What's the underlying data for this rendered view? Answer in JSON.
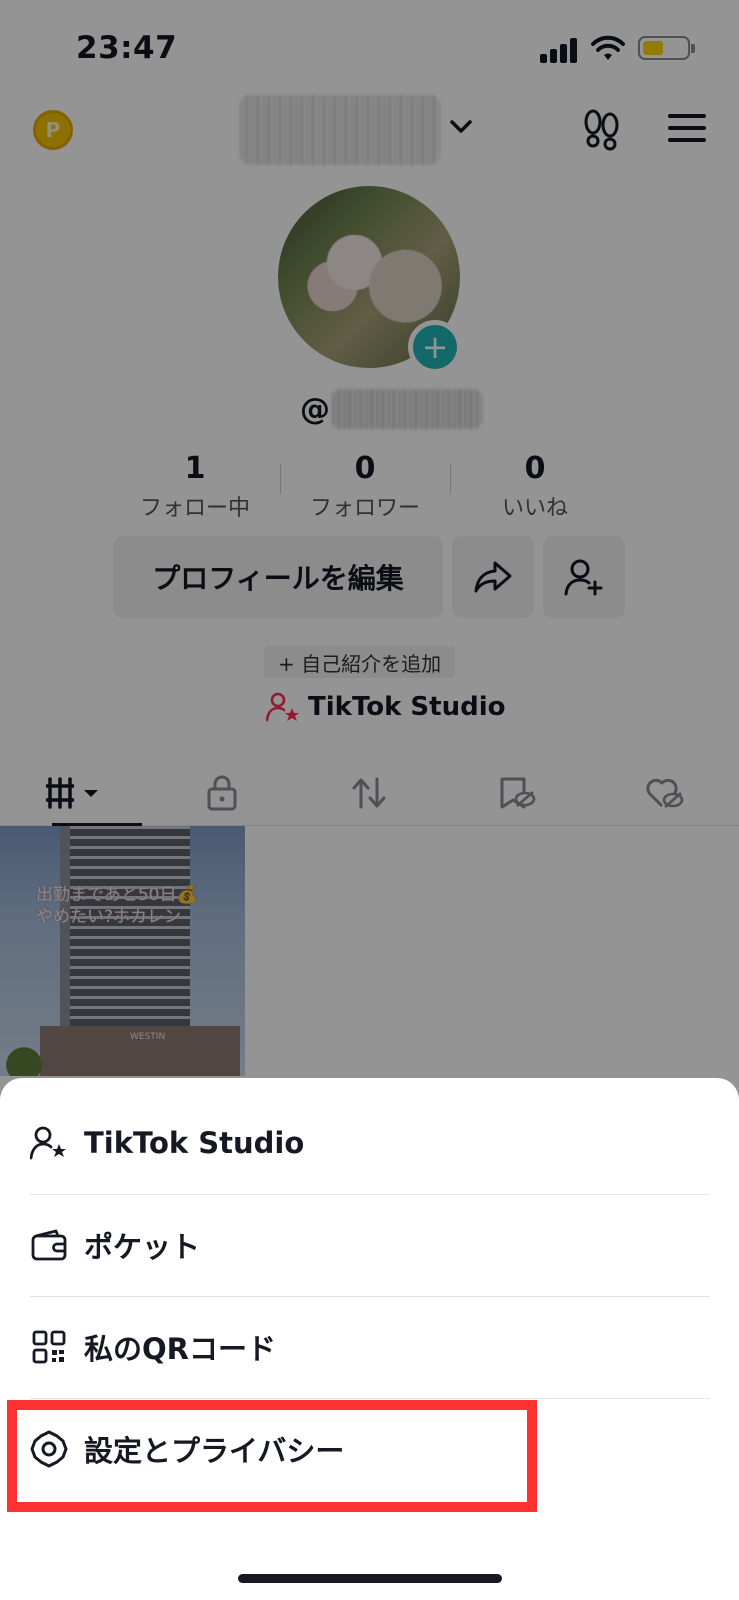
{
  "status_bar": {
    "time": "23:47",
    "battery_color": "#ffd600",
    "icons": [
      "signal-icon",
      "wifi-icon",
      "battery-icon"
    ]
  },
  "header": {
    "coin_symbol": "P",
    "icons": [
      "coin-icon",
      "chevron-down-icon",
      "footprints-icon",
      "menu-icon"
    ]
  },
  "profile": {
    "handle_prefix": "@",
    "stats": [
      {
        "value": "1",
        "label": "フォロー中"
      },
      {
        "value": "0",
        "label": "フォロワー"
      },
      {
        "value": "0",
        "label": "いいね"
      }
    ],
    "edit_button": "プロフィールを編集",
    "bio_add": "+ 自己紹介を追加",
    "studio_link": "TikTok Studio",
    "accent_color": "#22b3b5",
    "studio_icon_color": "#fe2c55"
  },
  "tabs": [
    {
      "icon": "grid-icon",
      "active": true
    },
    {
      "icon": "lock-icon",
      "active": false
    },
    {
      "icon": "repost-icon",
      "active": false
    },
    {
      "icon": "saved-hidden-icon",
      "active": false
    },
    {
      "icon": "liked-hidden-icon",
      "active": false
    }
  ],
  "video": {
    "caption": "出勤まであと50日💰\nやめたい?ホカレン",
    "sign": "WESTIN"
  },
  "menu": {
    "items": [
      {
        "label": "TikTok Studio",
        "icon": "person-star-icon"
      },
      {
        "label": "ポケット",
        "icon": "wallet-icon"
      },
      {
        "label": "私のQRコード",
        "icon": "qr-code-icon"
      },
      {
        "label": "設定とプライバシー",
        "icon": "gear-icon"
      }
    ],
    "highlight_color": "#ff3131"
  }
}
